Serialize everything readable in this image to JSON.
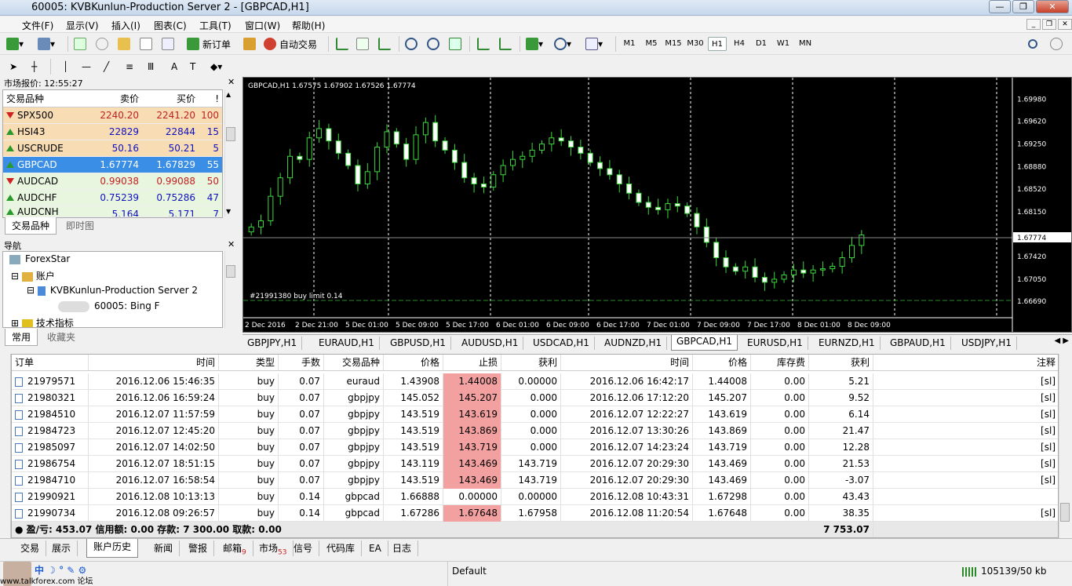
{
  "window": {
    "title": "60005: KVBKunlun-Production Server 2 - [GBPCAD,H1]"
  },
  "menu": [
    "文件(F)",
    "显示(V)",
    "插入(I)",
    "图表(C)",
    "工具(T)",
    "窗口(W)",
    "帮助(H)"
  ],
  "toolbar": {
    "new_order": "新订单",
    "auto_trade": "自动交易",
    "timeframes": [
      "M1",
      "M5",
      "M15",
      "M30",
      "H1",
      "H4",
      "D1",
      "W1",
      "MN"
    ],
    "active_tf": "H1"
  },
  "market_watch": {
    "title": "市场报价: 12:55:27",
    "headers": {
      "symbol": "交易品种",
      "bid": "卖价",
      "ask": "买价",
      "spread": "!"
    },
    "rows": [
      {
        "symbol": "SPX500",
        "bid": "2240.20",
        "ask": "2241.20",
        "spread": "100",
        "dir": "down",
        "hl": "orange"
      },
      {
        "symbol": "HSI43",
        "bid": "22829",
        "ask": "22844",
        "spread": "15",
        "dir": "up",
        "hl": "orange"
      },
      {
        "symbol": "USCRUDE",
        "bid": "50.16",
        "ask": "50.21",
        "spread": "5",
        "dir": "up",
        "hl": "orange"
      },
      {
        "symbol": "GBPCAD",
        "bid": "1.67774",
        "ask": "1.67829",
        "spread": "55",
        "dir": "up",
        "hl": "selected"
      },
      {
        "symbol": "AUDCAD",
        "bid": "0.99038",
        "ask": "0.99088",
        "spread": "50",
        "dir": "down",
        "hl": "green"
      },
      {
        "symbol": "AUDCHF",
        "bid": "0.75239",
        "ask": "0.75286",
        "spread": "47",
        "dir": "up",
        "hl": "green"
      },
      {
        "symbol": "AUDCNH",
        "bid": "5.164",
        "ask": "5.171",
        "spread": "7",
        "dir": "up",
        "hl": "green"
      }
    ],
    "tabs": [
      "交易品种",
      "即时图"
    ]
  },
  "navigator": {
    "title": "导航",
    "items": [
      "ForexStar",
      "账户",
      "KVBKunlun-Production Server 2",
      "60005: Bing F",
      "技术指标"
    ],
    "tabs": [
      "常用",
      "收藏夹"
    ]
  },
  "chart": {
    "header": "GBPCAD,H1  1.67575 1.67902 1.67526 1.67774",
    "order_label": "#21991380 buy limit 0.14",
    "current_price": "1.67774",
    "price_ticks": [
      "1.69980",
      "1.69620",
      "1.69250",
      "1.68880",
      "1.68520",
      "1.68150",
      "1.67420",
      "1.67050",
      "1.66690"
    ],
    "time_ticks": [
      "2 Dec 2016",
      "2 Dec 21:00",
      "5 Dec 01:00",
      "5 Dec 09:00",
      "5 Dec 17:00",
      "6 Dec 01:00",
      "6 Dec 09:00",
      "6 Dec 17:00",
      "7 Dec 01:00",
      "7 Dec 09:00",
      "7 Dec 17:00",
      "8 Dec 01:00",
      "8 Dec 09:00"
    ],
    "tabs": [
      "GBPJPY,H1",
      "EURAUD,H1",
      "GBPUSD,H1",
      "AUDUSD,H1",
      "USDCAD,H1",
      "AUDNZD,H1",
      "GBPCAD,H1",
      "EURUSD,H1",
      "EURNZD,H1",
      "GBPAUD,H1",
      "USDJPY,H1"
    ],
    "active_tab": "GBPCAD,H1"
  },
  "chart_data": {
    "type": "candlestick",
    "symbol": "GBPCAD",
    "timeframe": "H1",
    "ylim": [
      1.665,
      1.701
    ],
    "closes": [
      1.679,
      1.68,
      1.684,
      1.687,
      1.6905,
      1.69,
      1.6935,
      1.695,
      1.693,
      1.691,
      1.689,
      1.686,
      1.688,
      1.692,
      1.6945,
      1.6925,
      1.69,
      1.694,
      1.696,
      1.693,
      1.6915,
      1.6895,
      1.687,
      1.686,
      1.6855,
      1.6875,
      1.689,
      1.69,
      1.6905,
      1.6915,
      1.6925,
      1.6935,
      1.693,
      1.692,
      1.691,
      1.6895,
      1.6885,
      1.6875,
      1.686,
      1.6845,
      1.683,
      1.6822,
      1.6818,
      1.6828,
      1.6824,
      1.6812,
      1.679,
      1.6765,
      1.674,
      1.6725,
      1.6718,
      1.6725,
      1.6708,
      1.67,
      1.6705,
      1.6712,
      1.672,
      1.6715,
      1.672,
      1.6722,
      1.6726,
      1.674,
      1.676,
      1.6777
    ]
  },
  "terminal": {
    "headers": [
      "订单",
      "时间",
      "类型",
      "手数",
      "交易品种",
      "价格",
      "止损",
      "获利",
      "时间",
      "价格",
      "库存费",
      "获利",
      "注释"
    ],
    "rows": [
      [
        "21979571",
        "2016.12.06 15:46:35",
        "buy",
        "0.07",
        "euraud",
        "1.43908",
        "1.44008",
        "0.00000",
        "2016.12.06 16:42:17",
        "1.44008",
        "0.00",
        "5.21",
        "[sl]"
      ],
      [
        "21980321",
        "2016.12.06 16:59:24",
        "buy",
        "0.07",
        "gbpjpy",
        "145.052",
        "145.207",
        "0.000",
        "2016.12.06 17:12:20",
        "145.207",
        "0.00",
        "9.52",
        "[sl]"
      ],
      [
        "21984510",
        "2016.12.07 11:57:59",
        "buy",
        "0.07",
        "gbpjpy",
        "143.519",
        "143.619",
        "0.000",
        "2016.12.07 12:22:27",
        "143.619",
        "0.00",
        "6.14",
        "[sl]"
      ],
      [
        "21984723",
        "2016.12.07 12:45:20",
        "buy",
        "0.07",
        "gbpjpy",
        "143.519",
        "143.869",
        "0.000",
        "2016.12.07 13:30:26",
        "143.869",
        "0.00",
        "21.47",
        "[sl]"
      ],
      [
        "21985097",
        "2016.12.07 14:02:50",
        "buy",
        "0.07",
        "gbpjpy",
        "143.519",
        "143.719",
        "0.000",
        "2016.12.07 14:23:24",
        "143.719",
        "0.00",
        "12.28",
        "[sl]"
      ],
      [
        "21986754",
        "2016.12.07 18:51:15",
        "buy",
        "0.07",
        "gbpjpy",
        "143.119",
        "143.469",
        "143.719",
        "2016.12.07 20:29:30",
        "143.469",
        "0.00",
        "21.53",
        "[sl]"
      ],
      [
        "21984710",
        "2016.12.07 16:58:54",
        "buy",
        "0.07",
        "gbpjpy",
        "143.519",
        "143.469",
        "143.719",
        "2016.12.07 20:29:30",
        "143.469",
        "0.00",
        "-3.07",
        "[sl]"
      ],
      [
        "21990921",
        "2016.12.08 10:13:13",
        "buy",
        "0.14",
        "gbpcad",
        "1.66888",
        "0.00000",
        "0.00000",
        "2016.12.08 10:43:31",
        "1.67298",
        "0.00",
        "43.43",
        ""
      ],
      [
        "21990734",
        "2016.12.08 09:26:57",
        "buy",
        "0.14",
        "gbpcad",
        "1.67286",
        "1.67648",
        "1.67958",
        "2016.12.08 11:20:54",
        "1.67648",
        "0.00",
        "38.35",
        "[sl]"
      ]
    ],
    "summary": "盈/亏: 453.07  信用额: 0.00  存款: 7 300.00  取款: 0.00",
    "summary_total": "7 753.07",
    "tabs": [
      "交易",
      "展示",
      "账户历史",
      "新闻",
      "警报",
      "邮箱",
      "市场",
      "信号",
      "代码库",
      "EA",
      "日志"
    ],
    "badges": {
      "邮箱": "9",
      "市场": "53"
    },
    "active_tab": "账户历史"
  },
  "status": {
    "profile": "Default",
    "traffic": "105139/50 kb",
    "watermark": "www.talkforex.com 论坛"
  }
}
